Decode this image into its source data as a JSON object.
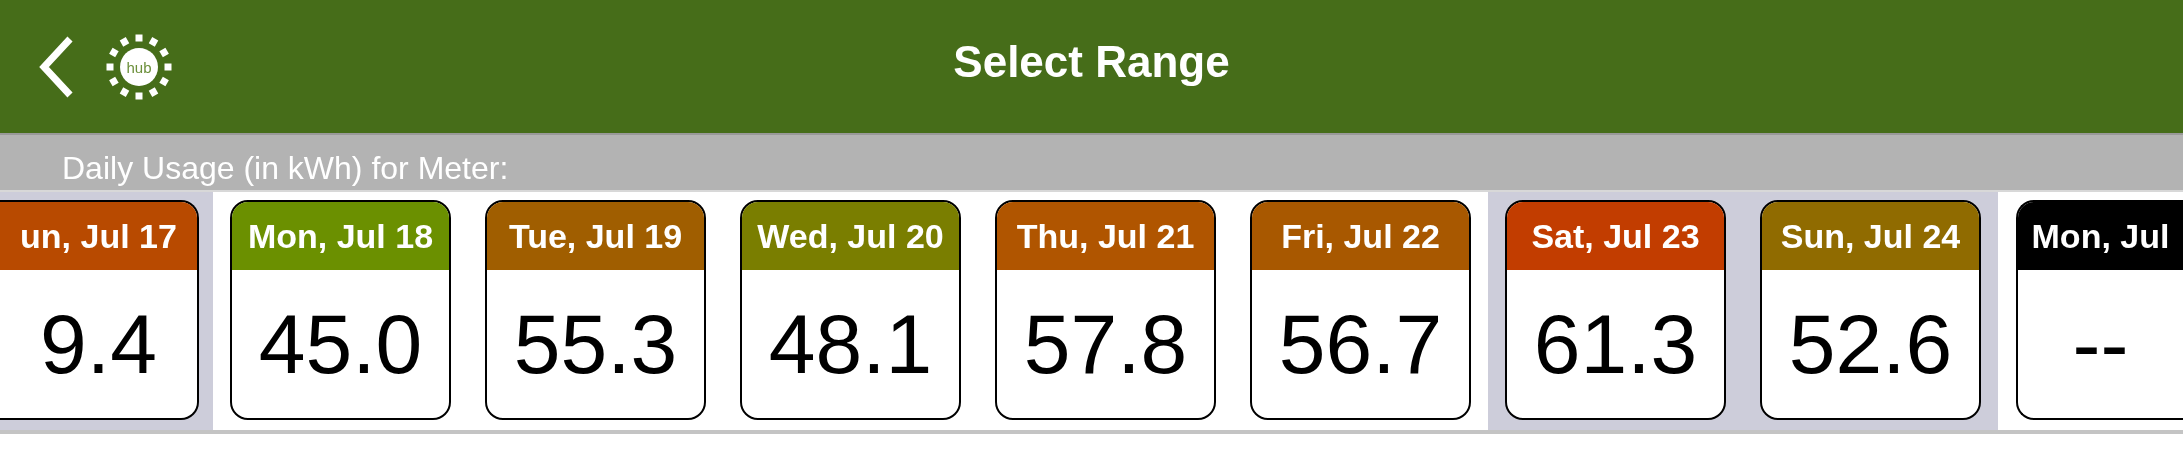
{
  "header": {
    "title": "Select Range",
    "logo_text": "hub"
  },
  "section_label": "Daily Usage (in kWh) for Meter:",
  "days": [
    {
      "date": "un, Jul 17",
      "value": "9.4",
      "color": "#b84a00",
      "weekend": true
    },
    {
      "date": "Mon, Jul 18",
      "value": "45.0",
      "color": "#6b9000",
      "weekend": false
    },
    {
      "date": "Tue, Jul 19",
      "value": "55.3",
      "color": "#a05e00",
      "weekend": false
    },
    {
      "date": "Wed, Jul 20",
      "value": "48.1",
      "color": "#7a7e00",
      "weekend": false
    },
    {
      "date": "Thu, Jul 21",
      "value": "57.8",
      "color": "#b05500",
      "weekend": false
    },
    {
      "date": "Fri, Jul 22",
      "value": "56.7",
      "color": "#a85800",
      "weekend": false
    },
    {
      "date": "Sat, Jul 23",
      "value": "61.3",
      "color": "#c23d00",
      "weekend": true
    },
    {
      "date": "Sun, Jul 24",
      "value": "52.6",
      "color": "#906b00",
      "weekend": true
    },
    {
      "date": "Mon, Jul",
      "value": "--",
      "color": "#000000",
      "weekend": false
    }
  ]
}
